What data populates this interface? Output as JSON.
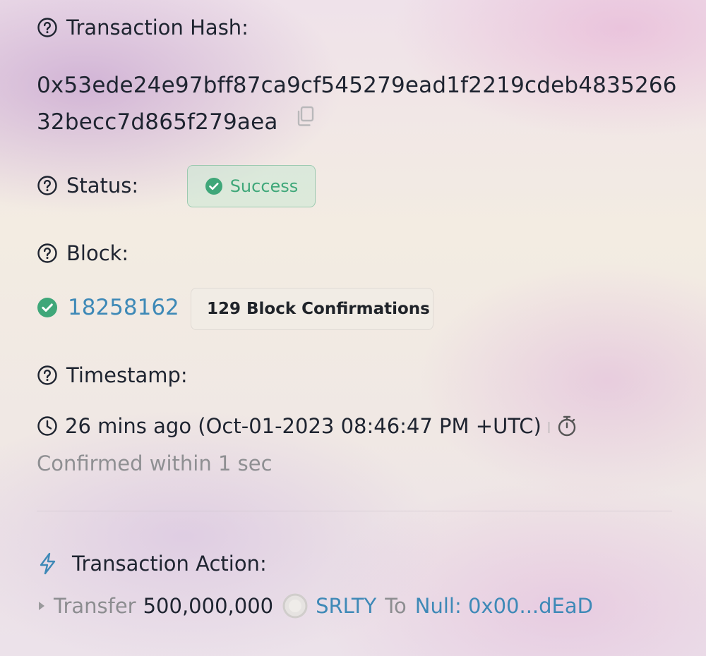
{
  "transaction_hash": {
    "label": "Transaction Hash:",
    "line1": "0x53ede24e97bff87ca9cf545279ead1f2219cdeb4835266",
    "line2": "32becc7d865f279aea",
    "copy_icon": "copy-icon"
  },
  "status": {
    "label": "Status:",
    "value": "Success",
    "color": "#3fa779"
  },
  "block": {
    "label": "Block:",
    "number": "18258162",
    "confirmations": "129 Block Confirmations"
  },
  "timestamp": {
    "label": "Timestamp:",
    "value": "26 mins ago (Oct-01-2023 08:46:47 PM +UTC)",
    "separator": "|",
    "confirmed": "Confirmed within 1 sec"
  },
  "transaction_action": {
    "label": "Transaction Action:",
    "verb": "Transfer",
    "amount": "500,000,000",
    "token": "SRLTY",
    "to_word": "To",
    "recipient": "Null: 0x00...dEaD"
  },
  "colors": {
    "link": "#3e89b7",
    "success": "#3fa779",
    "muted": "#8e8f92"
  }
}
